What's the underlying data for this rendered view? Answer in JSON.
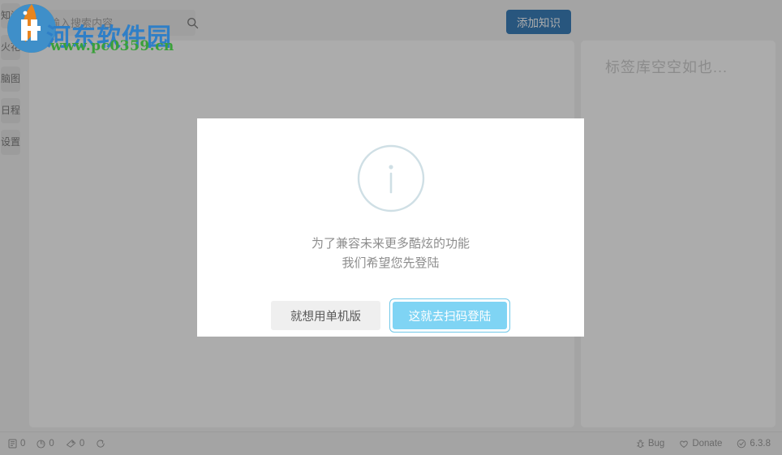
{
  "sidebar": {
    "items": [
      {
        "label": "知识",
        "name": "sidebar-item-knowledge"
      },
      {
        "label": "火花",
        "name": "sidebar-item-spark"
      },
      {
        "label": "脑图",
        "name": "sidebar-item-mindmap"
      },
      {
        "label": "日程",
        "name": "sidebar-item-schedule"
      },
      {
        "label": "设置",
        "name": "sidebar-item-settings"
      }
    ]
  },
  "header": {
    "search_placeholder": "请输入搜索内容",
    "search_value": "",
    "search_icon": "search-icon",
    "add_button_label": "添加知识",
    "add_button_color": "#1d6bb0"
  },
  "side_panel": {
    "empty_text": "标签库空空如也..."
  },
  "statusbar": {
    "left": [
      {
        "icon": "document-icon",
        "value": "0"
      },
      {
        "icon": "pie-chart-icon",
        "value": "0"
      },
      {
        "icon": "tag-icon",
        "value": "0"
      },
      {
        "icon": "sync-icon",
        "value": ""
      }
    ],
    "right": [
      {
        "icon": "bug-icon",
        "label": "Bug"
      },
      {
        "icon": "heart-icon",
        "label": "Donate"
      },
      {
        "icon": "check-circle-icon",
        "label": "6.3.8"
      }
    ]
  },
  "dialog": {
    "icon": "info-circle-icon",
    "message_line1": "为了兼容未来更多酷炫的功能",
    "message_line2": "我们希望您先登陆",
    "secondary_button": "就想用单机版",
    "primary_button": "这就去扫码登陆",
    "primary_color": "#7fd4f4"
  },
  "watermark": {
    "brand_text": "河东软件园",
    "url_text": "www.pc0359.cn",
    "brand_color": "#2f7fc7",
    "url_color": "#3aa03a"
  }
}
